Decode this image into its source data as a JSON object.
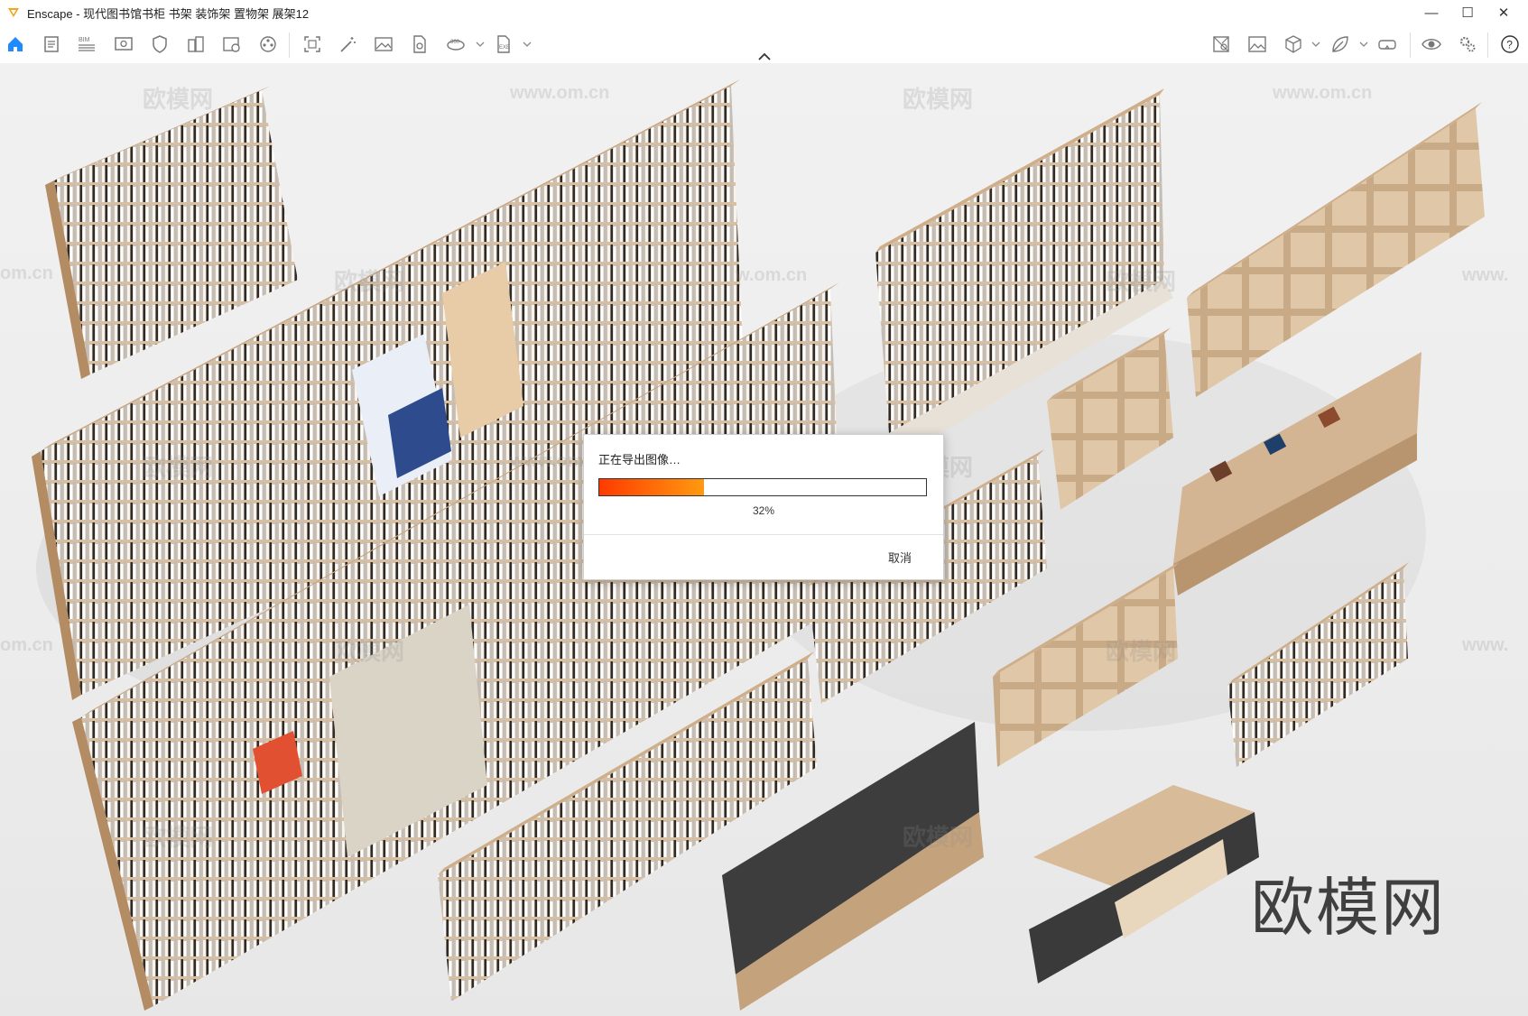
{
  "window": {
    "title": "Enscape - 现代图书馆书柜 书架 装饰架 置物架 展架12"
  },
  "window_controls": {
    "minimize": "—",
    "maximize": "☐",
    "close": "✕"
  },
  "colors": {
    "accent": "#f7a21b",
    "home_icon": "#1e8cff",
    "progress_start": "#ff3a00",
    "progress_end": "#ff9a10"
  },
  "toolbar": {
    "left_icons": [
      "home-icon",
      "document-icon",
      "bim-icon",
      "screen-icon",
      "shield-icon",
      "buildings-icon",
      "video-capture-icon",
      "film-reel-icon",
      "capture-frame-icon",
      "magic-wand-icon",
      "image-icon",
      "file-export-icon",
      "panorama-360-icon",
      "exe-export-icon"
    ],
    "bim_label": "BIM",
    "right_icons": [
      "map-icon",
      "gallery-icon",
      "cube-icon",
      "leaf-icon",
      "vr-headset-icon",
      "eye-icon",
      "settings-icon",
      "help-icon"
    ]
  },
  "viewport": {
    "watermarks": [
      "欧模网",
      "www.om.cn",
      "欧模网",
      "www.om.cn",
      "om.cn",
      "欧模网",
      "w.om.cn",
      "欧模网",
      "www.",
      "www.om.cn",
      "欧模网",
      "欧模网",
      "om.cn",
      "欧模网",
      "欧模网",
      "www.",
      "欧模网",
      "欧模网"
    ],
    "brand_watermark": "欧模网"
  },
  "dialog": {
    "title": "正在导出图像…",
    "progress": 0.32,
    "percent_label": "32%",
    "cancel_label": "取消"
  }
}
